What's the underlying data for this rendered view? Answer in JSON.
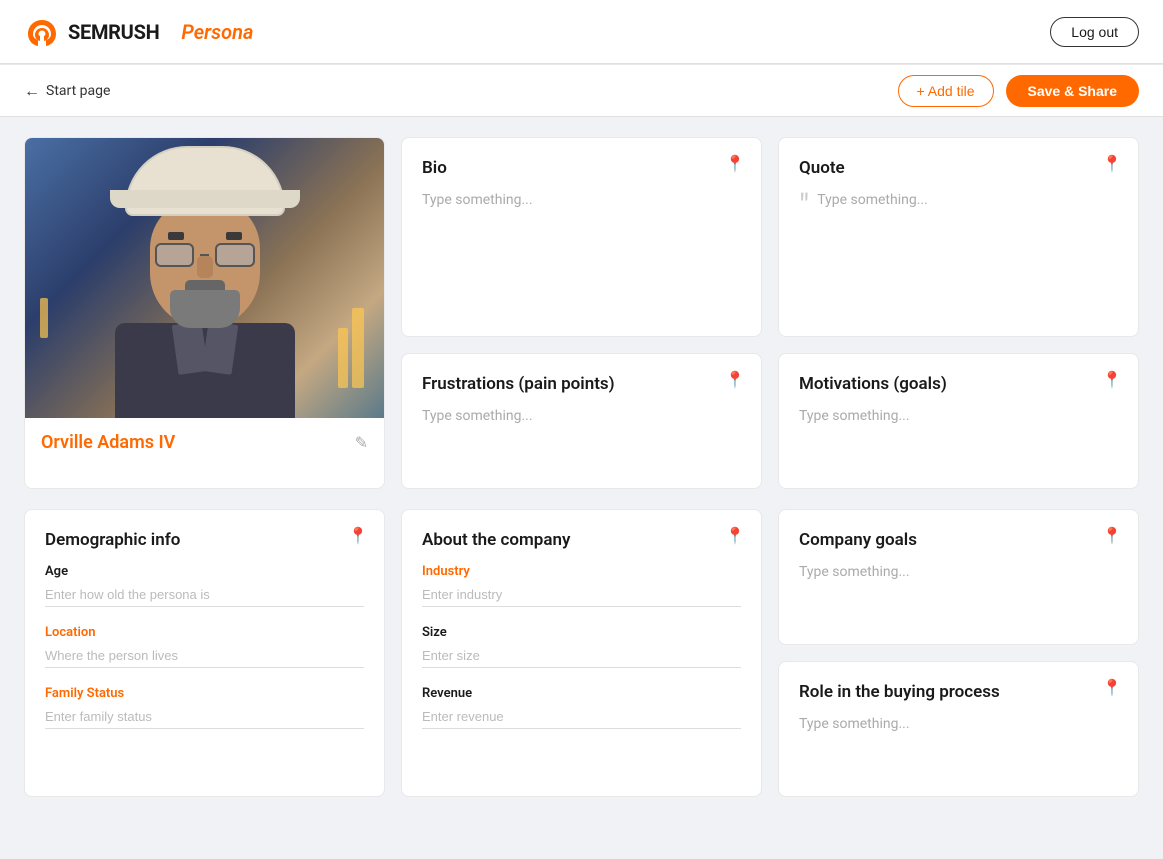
{
  "header": {
    "brand": "SEMRUSH",
    "product": "Persona",
    "logout_label": "Log out"
  },
  "nav": {
    "back_label": "Start page",
    "add_tile_label": "+ Add tile",
    "save_share_label": "Save & Share"
  },
  "persona_card": {
    "name_prefix": "Orville Adams ",
    "name_highlight": "IV",
    "edit_icon": "✎"
  },
  "bio_card": {
    "title": "Bio",
    "placeholder": "Type something...",
    "pin_icon": "📌"
  },
  "quote_card": {
    "title": "Quote",
    "placeholder": "Type something...",
    "pin_icon": "📌"
  },
  "frustrations_card": {
    "title": "Frustrations (pain points)",
    "placeholder": "Type something...",
    "pin_icon": "📌"
  },
  "motivations_card": {
    "title": "Motivations (goals)",
    "placeholder": "Type something...",
    "pin_icon": "📌"
  },
  "demographic_card": {
    "title": "Demographic info",
    "pin_icon": "📌",
    "fields": [
      {
        "label": "Age",
        "label_color": "black",
        "placeholder": "Enter how old the persona is"
      },
      {
        "label": "Location",
        "label_color": "orange",
        "placeholder": "Where the person lives"
      },
      {
        "label": "Family Status",
        "label_color": "orange",
        "placeholder": "Enter family status"
      }
    ]
  },
  "company_card": {
    "title": "About the company",
    "pin_icon": "📌",
    "fields": [
      {
        "label": "Industry",
        "label_color": "orange",
        "placeholder": "Enter industry"
      },
      {
        "label": "Size",
        "label_color": "black",
        "placeholder": "Enter size"
      },
      {
        "label": "Revenue",
        "label_color": "black",
        "placeholder": "Enter revenue"
      }
    ]
  },
  "company_goals_card": {
    "title": "Company goals",
    "placeholder": "Type something...",
    "pin_icon": "📌"
  },
  "role_card": {
    "title": "Role in the buying process",
    "placeholder": "Type something...",
    "pin_icon": "📌"
  }
}
